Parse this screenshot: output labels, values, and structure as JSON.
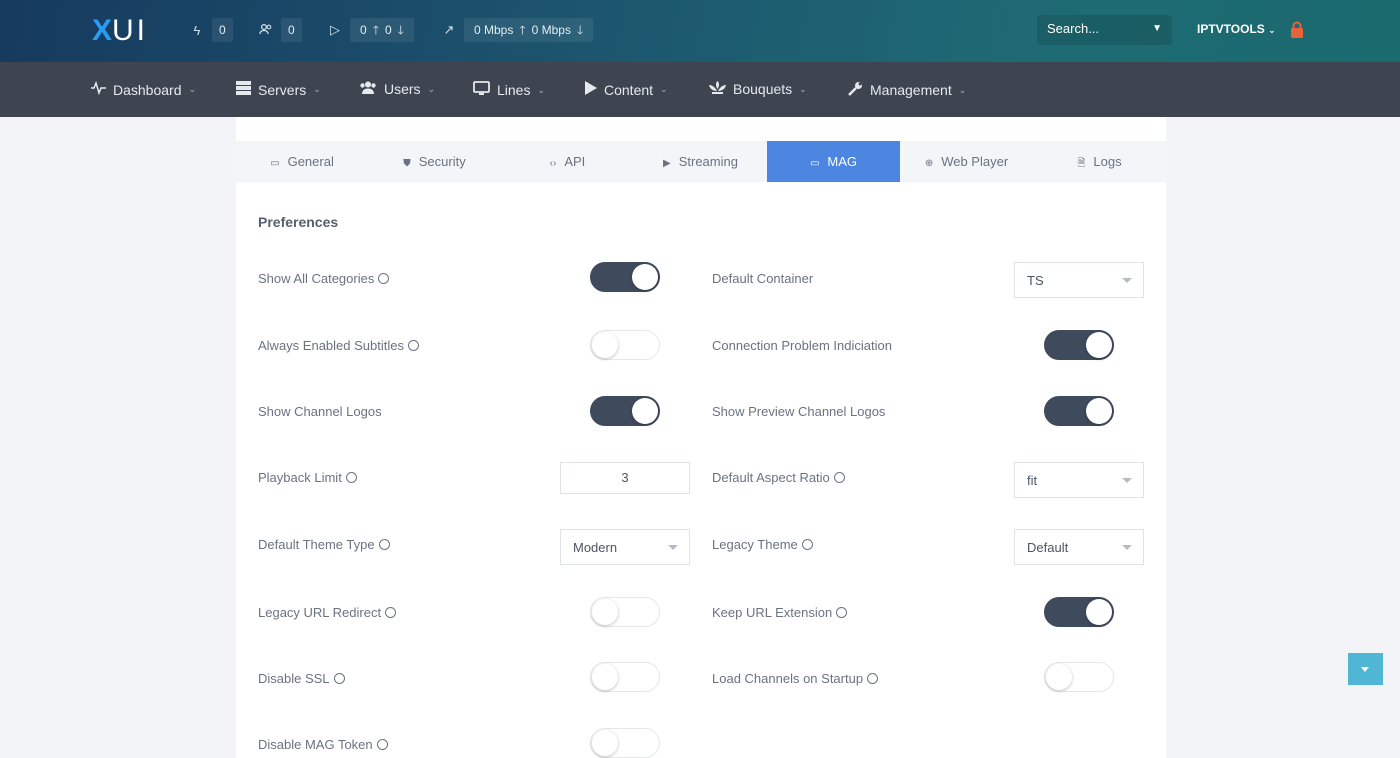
{
  "header": {
    "logo_x": "X",
    "logo_rest": "UI",
    "stats": {
      "connections": "0",
      "users": "0",
      "streams_up": "0",
      "streams_down": "0",
      "bandwidth_up": "0 Mbps",
      "bandwidth_down": "0 Mbps"
    },
    "search_placeholder": "Search...",
    "username": "IPTVTOOLS"
  },
  "nav": [
    {
      "label": "Dashboard",
      "icon": "activity-icon"
    },
    {
      "label": "Servers",
      "icon": "server-icon"
    },
    {
      "label": "Users",
      "icon": "users-icon"
    },
    {
      "label": "Lines",
      "icon": "monitor-icon"
    },
    {
      "label": "Content",
      "icon": "play-icon"
    },
    {
      "label": "Bouquets",
      "icon": "flower-icon"
    },
    {
      "label": "Management",
      "icon": "wrench-icon"
    }
  ],
  "tabs": [
    {
      "label": "General",
      "active": false
    },
    {
      "label": "Security",
      "active": false
    },
    {
      "label": "API",
      "active": false
    },
    {
      "label": "Streaming",
      "active": false
    },
    {
      "label": "MAG",
      "active": true
    },
    {
      "label": "Web Player",
      "active": false
    },
    {
      "label": "Logs",
      "active": false
    }
  ],
  "section_title": "Preferences",
  "left_fields": [
    {
      "label": "Show All Categories",
      "type": "toggle",
      "on": true
    },
    {
      "label": "Always Enabled Subtitles",
      "type": "toggle",
      "on": false
    },
    {
      "label": "Show Channel Logos",
      "type": "toggle",
      "on": true
    },
    {
      "label": "Playback Limit",
      "type": "number",
      "value": "3"
    },
    {
      "label": "Default Theme Type",
      "type": "select",
      "value": "Modern"
    },
    {
      "label": "Legacy URL Redirect",
      "type": "toggle",
      "on": false
    },
    {
      "label": "Disable SSL",
      "type": "toggle",
      "on": false
    },
    {
      "label": "Disable MAG Token",
      "type": "toggle",
      "on": false
    }
  ],
  "right_fields": [
    {
      "label": "Default Container",
      "type": "select",
      "value": "TS"
    },
    {
      "label": "Connection Problem Indiciation",
      "type": "toggle",
      "on": true
    },
    {
      "label": "Show Preview Channel Logos",
      "type": "toggle",
      "on": true
    },
    {
      "label": "Default Aspect Ratio",
      "type": "select",
      "value": "fit"
    },
    {
      "label": "Legacy Theme",
      "type": "select",
      "value": "Default"
    },
    {
      "label": "Keep URL Extension",
      "type": "toggle",
      "on": true
    },
    {
      "label": "Load Channels on Startup",
      "type": "toggle",
      "on": false
    }
  ],
  "colors": {
    "accent": "#4c86e0",
    "toggle_on": "#3f4a5c",
    "lock": "#e8623a",
    "scroll_button": "#4fb7d5"
  }
}
